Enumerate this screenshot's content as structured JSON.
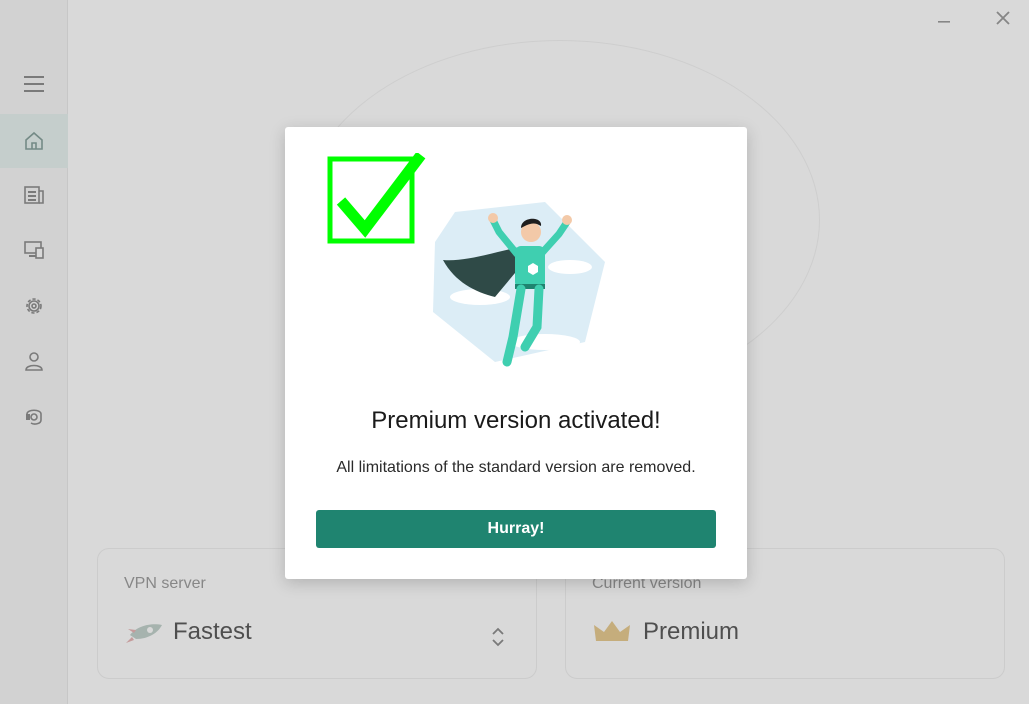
{
  "window": {
    "minimize_icon": "minimize-icon",
    "close_icon": "close-icon"
  },
  "sidebar": {
    "items": [
      {
        "icon": "menu-icon",
        "active": false
      },
      {
        "icon": "home-icon",
        "active": true
      },
      {
        "icon": "news-icon",
        "active": false
      },
      {
        "icon": "devices-icon",
        "active": false
      },
      {
        "icon": "gear-icon",
        "active": false
      },
      {
        "icon": "user-icon",
        "active": false
      },
      {
        "icon": "support-icon",
        "active": false
      }
    ]
  },
  "cards": {
    "vpn_server": {
      "label": "VPN server",
      "value": "Fastest",
      "icon": "rocket-icon"
    },
    "version": {
      "label": "Current version",
      "value": "Premium",
      "icon": "crown-icon"
    }
  },
  "modal": {
    "title": "Premium version activated!",
    "description": "All limitations of the standard version are removed.",
    "button_label": "Hurray!",
    "illustration": "superhero-illustration",
    "check_icon": "checkmark-icon"
  },
  "colors": {
    "accent": "#1f8470",
    "check_green": "#00ff00",
    "overlay": "rgba(128,128,128,0.30)"
  }
}
